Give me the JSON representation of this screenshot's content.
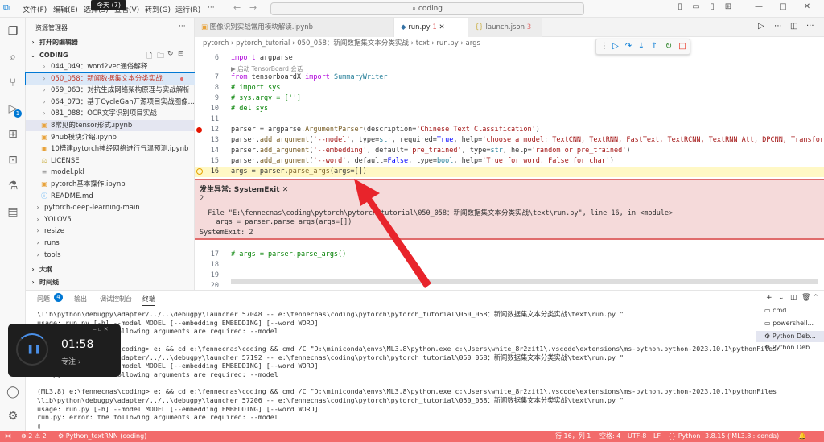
{
  "titlebar": {
    "menus": [
      "文件(F)",
      "编辑(E)",
      "选择(S)",
      "查看(V)",
      "转到(G)",
      "运行(R)"
    ],
    "tooltip": "今天 (7)",
    "search": "coding"
  },
  "sidebar": {
    "header": "资源管理器",
    "open_editors": "打开的编辑器",
    "root": "CODING",
    "items": [
      {
        "label": "044_049：word2vec通俗解释",
        "indent": 1,
        "icon": "folder"
      },
      {
        "label": "050_058：新闻数据集文本分类实战",
        "indent": 1,
        "icon": "folder",
        "state": "active"
      },
      {
        "label": "059_063：对抗生成网络架构原理与实战解析",
        "indent": 1,
        "icon": "folder"
      },
      {
        "label": "064_073：基于CycleGan开源项目实战图像...",
        "indent": 1,
        "icon": "folder"
      },
      {
        "label": "081_088：OCR文字识别项目实战",
        "indent": 1,
        "icon": "folder"
      },
      {
        "label": "8常见的tensor形式.ipynb",
        "indent": 1,
        "icon": "nb",
        "state": "sel"
      },
      {
        "label": "9hub模块介绍.ipynb",
        "indent": 1,
        "icon": "nb"
      },
      {
        "label": "10搭建pytorch神经网络进行气温预测.ipynb",
        "indent": 1,
        "icon": "nb"
      },
      {
        "label": "LICENSE",
        "indent": 1,
        "icon": "lic"
      },
      {
        "label": "model.pkl",
        "indent": 1,
        "icon": "file"
      },
      {
        "label": "pytorch基本操作.ipynb",
        "indent": 1,
        "icon": "nb"
      },
      {
        "label": "README.md",
        "indent": 1,
        "icon": "md"
      },
      {
        "label": "pytorch-deep-learning-main",
        "indent": 0,
        "icon": "chev"
      },
      {
        "label": "YOLOV5",
        "indent": 0,
        "icon": "chev"
      },
      {
        "label": "resize",
        "indent": 0,
        "icon": "chev"
      },
      {
        "label": "runs",
        "indent": 0,
        "icon": "chev"
      },
      {
        "label": "tools",
        "indent": 0,
        "icon": "chev"
      }
    ],
    "outline": "大纲",
    "timeline": "时间线"
  },
  "tabs": [
    {
      "label": "图像识别实战常用模块解读.ipynb",
      "active": false
    },
    {
      "label": "run.py",
      "badge": "1",
      "active": true
    },
    {
      "label": "launch.json",
      "badge": "3",
      "active": false
    }
  ],
  "breadcrumb": [
    "pytorch",
    "pytorch_tutorial",
    "050_058：新闻数据集文本分类实战",
    "text",
    "run.py",
    "args"
  ],
  "codelens": "启动 TensorBoard 会话",
  "code_top": [
    {
      "n": "6",
      "text": "import argparse"
    },
    {
      "n": "7",
      "text": "from tensorboardX import SummaryWriter"
    },
    {
      "n": "8",
      "text": "# import sys"
    },
    {
      "n": "9",
      "text": "# sys.argv = ['']"
    },
    {
      "n": "10",
      "text": "# del sys"
    },
    {
      "n": "11",
      "text": ""
    },
    {
      "n": "12",
      "text": "parser = argparse.ArgumentParser(description='Chinese Text Classification')"
    },
    {
      "n": "13",
      "text": "parser.add_argument('--model', type=str, required=True, help='choose a model: TextCNN, TextRNN, FastText, TextRCNN, TextRNN_Att, DPCNN, Transfor"
    },
    {
      "n": "14",
      "text": "parser.add_argument('--embedding', default='pre_trained', type=str, help='random or pre_trained')"
    },
    {
      "n": "15",
      "text": "parser.add_argument('--word', default=False, type=bool, help='True for word, False for char')"
    },
    {
      "n": "16",
      "text": "args = parser.parse_args(args=[])"
    }
  ],
  "exception": {
    "title": "发生异常: SystemExit",
    "code": "2",
    "file_line": "  File \"E:\\fennecnas\\coding\\pytorch\\pytorch_tutorial\\050_058：新闻数据集文本分类实战\\text\\run.py\", line 16, in <module>",
    "src_line": "    args = parser.parse_args(args=[])",
    "exit": "SystemExit: 2"
  },
  "code_bottom": [
    {
      "n": "17",
      "text": "# args = parser.parse_args()"
    },
    {
      "n": "18",
      "text": ""
    },
    {
      "n": "19",
      "text": ""
    },
    {
      "n": "20",
      "text": ""
    }
  ],
  "panel": {
    "tabs": [
      "问题",
      "输出",
      "调试控制台",
      "终端"
    ],
    "problems_count": "4",
    "terminal": [
      "\\lib\\python\\debugpy\\adapter/../..\\debugpy\\launcher 57048 -- e:\\fennecnas\\coding\\pytorch\\pytorch_tutorial\\050_058：新闻数据集文本分类实战\\text\\run.py \"",
      "usage: run.py [-h] --model MODEL [--embedding EMBEDDING] [--word WORD]",
      "run.py: error: the following arguments are required: --model",
      "",
      "(ML3.8) e:\\fennecnas\\coding> e: && cd e:\\fennecnas\\coding && cmd /C \"D:\\miniconda\\envs\\ML3.8\\python.exe c:\\Users\\white_8r2zit1\\.vscode\\extensions\\ms-python.python-2023.10.1\\pythonFiles",
      "\\lib\\python\\debugpy\\adapter/../..\\debugpy\\launcher 57192 -- e:\\fennecnas\\coding\\pytorch\\pytorch_tutorial\\050_058：新闻数据集文本分类实战\\text\\run.py \"",
      "usage: run.py [-h] --model MODEL [--embedding EMBEDDING] [--word WORD]",
      "run.py: error: the following arguments are required: --model",
      "",
      "(ML3.8) e:\\fennecnas\\coding> e: && cd e:\\fennecnas\\coding && cmd /C \"D:\\miniconda\\envs\\ML3.8\\python.exe c:\\Users\\white_8r2zit1\\.vscode\\extensions\\ms-python.python-2023.10.1\\pythonFiles",
      "\\lib\\python\\debugpy\\adapter/../..\\debugpy\\launcher 57206 -- e:\\fennecnas\\coding\\pytorch\\pytorch_tutorial\\050_058：新闻数据集文本分类实战\\text\\run.py \"",
      "usage: run.py [-h] --model MODEL [--embedding EMBEDDING] [--word WORD]",
      "run.py: error: the following arguments are required: --model",
      "▯"
    ],
    "terminals": [
      "cmd",
      "powershell...",
      "Python Deb...",
      "Python Deb..."
    ]
  },
  "timer": {
    "time": "01:58",
    "label": "专注"
  },
  "statusbar": {
    "problems": "⊗ 2 ⚠ 2",
    "run": "Python_textRNN (coding)",
    "position": "行 16，列 1",
    "spaces": "空格: 4",
    "encoding": "UTF-8",
    "eol": "LF",
    "lang": "{} Python",
    "interp": "3.8.15 ('ML3.8': conda)"
  },
  "colors": {
    "status": "#f26b6b",
    "accent": "#0078d4",
    "arrow": "#e8242b"
  }
}
